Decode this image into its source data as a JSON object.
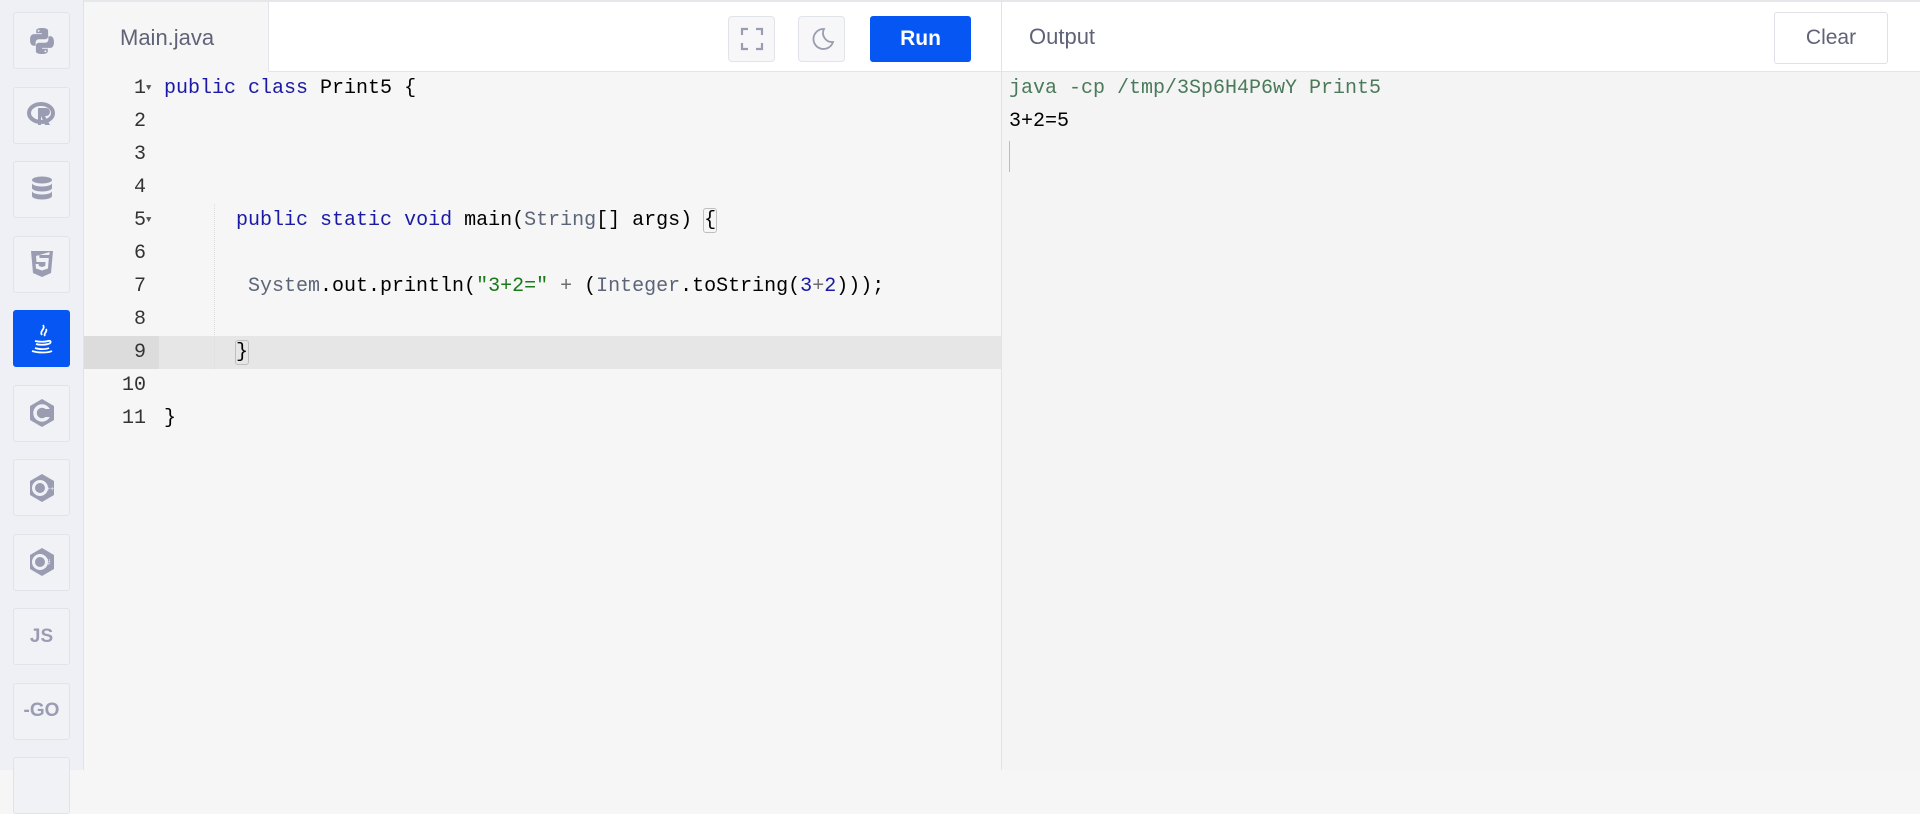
{
  "sidebar": {
    "items": [
      {
        "id": "python",
        "icon": "python-icon",
        "active": false
      },
      {
        "id": "r",
        "icon": "r-icon",
        "active": false
      },
      {
        "id": "sql",
        "icon": "database-icon",
        "active": false
      },
      {
        "id": "html",
        "icon": "html5-icon",
        "active": false
      },
      {
        "id": "java",
        "icon": "java-icon",
        "active": true
      },
      {
        "id": "c",
        "icon": "c-icon",
        "active": false
      },
      {
        "id": "cpp",
        "icon": "cpp-icon",
        "active": false
      },
      {
        "id": "csharp",
        "icon": "csharp-icon",
        "active": false
      },
      {
        "id": "js",
        "icon": "js-icon",
        "label": "JS",
        "active": false
      },
      {
        "id": "go",
        "icon": "go-icon",
        "label": "-GO",
        "active": false
      }
    ]
  },
  "editor": {
    "tab_label": "Main.java",
    "run_label": "Run",
    "active_line": 9,
    "lines": [
      [
        {
          "t": "public",
          "c": "kw"
        },
        {
          "t": " "
        },
        {
          "t": "class",
          "c": "kw"
        },
        {
          "t": " Print5 {"
        }
      ],
      [],
      [],
      [],
      [
        {
          "t": "      "
        },
        {
          "t": "public",
          "c": "kw"
        },
        {
          "t": " "
        },
        {
          "t": "static",
          "c": "kw"
        },
        {
          "t": " "
        },
        {
          "t": "void",
          "c": "kw"
        },
        {
          "t": " main("
        },
        {
          "t": "String",
          "c": "ty"
        },
        {
          "t": "[] args) "
        },
        {
          "t": "{",
          "c": "brace-hl"
        }
      ],
      [],
      [
        {
          "t": "       "
        },
        {
          "t": "System",
          "c": "ty"
        },
        {
          "t": ".out.println("
        },
        {
          "t": "\"3+2=\"",
          "c": "str"
        },
        {
          "t": " "
        },
        {
          "t": "+",
          "c": "op"
        },
        {
          "t": " ("
        },
        {
          "t": "Integer",
          "c": "ty"
        },
        {
          "t": ".toString("
        },
        {
          "t": "3",
          "c": "num"
        },
        {
          "t": "+",
          "c": "op"
        },
        {
          "t": "2",
          "c": "num"
        },
        {
          "t": ")));"
        }
      ],
      [],
      [
        {
          "t": "      "
        },
        {
          "t": "}",
          "c": "brace-hl"
        }
      ],
      [],
      [
        {
          "t": "}"
        }
      ]
    ],
    "fold_lines": [
      1,
      5
    ]
  },
  "output": {
    "title": "Output",
    "clear_label": "Clear",
    "lines": [
      {
        "text": "java -cp /tmp/3Sp6H4P6wY Print5",
        "color": "#4a7a5a"
      },
      {
        "text": "3+2=5",
        "color": "#000000"
      }
    ]
  },
  "colors": {
    "accent": "#0556f3"
  }
}
